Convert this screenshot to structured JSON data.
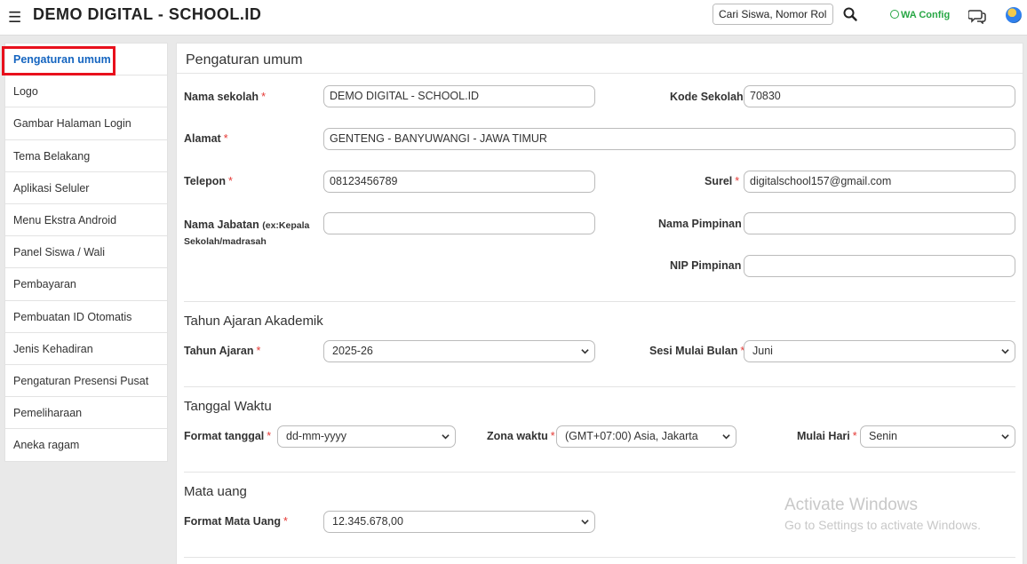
{
  "header": {
    "menu_icon": "hamburger-icon",
    "title": "DEMO DIGITAL - SCHOOL.ID",
    "search_value": "Cari Siswa, Nomor Rol, I",
    "search_icon": "search-icon",
    "wa_config": "WA Config",
    "wa_icon": "whatsapp-icon",
    "chat_icon": "chat-bubbles-icon",
    "avatar_icon": "globe-avatar-icon"
  },
  "sidebar": {
    "items": [
      {
        "label": "Pengaturan umum"
      },
      {
        "label": "Logo"
      },
      {
        "label": "Gambar Halaman Login"
      },
      {
        "label": "Tema Belakang"
      },
      {
        "label": "Aplikasi Seluler"
      },
      {
        "label": "Menu Ekstra Android"
      },
      {
        "label": "Panel Siswa / Wali"
      },
      {
        "label": "Pembayaran"
      },
      {
        "label": "Pembuatan ID Otomatis"
      },
      {
        "label": "Jenis Kehadiran"
      },
      {
        "label": "Pengaturan Presensi Pusat"
      },
      {
        "label": "Pemeliharaan"
      },
      {
        "label": "Aneka ragam"
      }
    ],
    "active_index": 0,
    "highlight_color": "#e8101c"
  },
  "main": {
    "title": "Pengaturan umum",
    "fields": {
      "nama_sekolah": {
        "label": "Nama sekolah",
        "value": "DEMO DIGITAL - SCHOOL.ID"
      },
      "kode_sekolah": {
        "label": "Kode Sekolah",
        "value": "70830"
      },
      "alamat": {
        "label": "Alamat",
        "value": "GENTENG - BANYUWANGI - JAWA TIMUR"
      },
      "telepon": {
        "label": "Telepon",
        "value": "08123456789"
      },
      "surel": {
        "label": "Surel",
        "value": "digitalschool157@gmail.com"
      },
      "nama_jabatan": {
        "label": "Nama Jabatan",
        "hint_1": "(ex:Kepala",
        "hint_2": "Sekolah/madrasah",
        "value": ""
      },
      "nama_pimpinan": {
        "label": "Nama Pimpinan",
        "value": ""
      },
      "nip_pimpinan": {
        "label": "NIP Pimpinan",
        "value": ""
      }
    },
    "academic": {
      "title": "Tahun Ajaran Akademik",
      "tahun_ajaran": {
        "label": "Tahun Ajaran",
        "value": "2025-26"
      },
      "sesi_mulai_bulan": {
        "label": "Sesi Mulai Bulan",
        "value": "Juni"
      }
    },
    "datetime": {
      "title": "Tanggal Waktu",
      "format_tanggal": {
        "label": "Format tanggal",
        "value": "dd-mm-yyyy"
      },
      "zona_waktu": {
        "label": "Zona waktu",
        "value": "(GMT+07:00) Asia, Jakarta"
      },
      "mulai_hari": {
        "label": "Mulai Hari",
        "value": "Senin"
      }
    },
    "currency": {
      "title": "Mata uang",
      "format_mata_uang": {
        "label": "Format Mata Uang",
        "value": "12.345.678,00"
      }
    },
    "required_mark": "*"
  },
  "watermark": {
    "line1": "Activate Windows",
    "line2": "Go to Settings to activate Windows."
  },
  "colors": {
    "accent_blue": "#1565c0",
    "required_red": "#e53935",
    "wa_green": "#28a745"
  }
}
